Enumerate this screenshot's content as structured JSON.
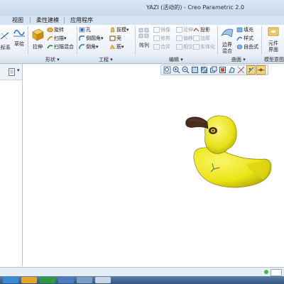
{
  "window": {
    "title": "YAZI (活动的) - Creo Parametric 2.0"
  },
  "tabs": [
    {
      "label": "视图",
      "active": false
    },
    {
      "label": "柔性建模",
      "active": false
    },
    {
      "label": "应用程序",
      "active": false
    }
  ],
  "ribbon": {
    "datum": {
      "axis_label": "坐标系",
      "sketch_label": "草绘"
    },
    "shapes": {
      "extrude": "拉伸",
      "revolve": "旋转",
      "sweep": "扫描",
      "swept_blend": "扫描混合",
      "group_label": "形状"
    },
    "engineering": {
      "hole": "孔",
      "round": "倒圆角",
      "chamfer": "倒角",
      "draft": "拔模",
      "shell": "壳",
      "rib": "筋",
      "group_label": "工程"
    },
    "editing": {
      "pattern": "阵列",
      "mirror": "镜像",
      "merge": "合并",
      "trim": "修剪",
      "intersect": "相交",
      "extend": "延伸",
      "offset": "偏移",
      "project": "投影",
      "thicken": "加厚",
      "solidify": "实体化",
      "group_label": "编辑"
    },
    "surfaces": {
      "boundary": "边界",
      "boundary2": "混合",
      "fill": "填充",
      "style": "样式",
      "freestyle": "自由式",
      "group_label": "曲面"
    },
    "model_intent": {
      "label1": "元件",
      "label2": "界面",
      "group_label": "模型意图"
    }
  },
  "left_panel": {
    "tab_icon": "document-icon"
  },
  "model": {
    "name": "duck",
    "body_color": "#ebe515",
    "bill_color": "#4a2e1c"
  },
  "colors": {
    "ribbon_accent": "#1f6fbf",
    "taskbar": "#3b5f8a"
  }
}
